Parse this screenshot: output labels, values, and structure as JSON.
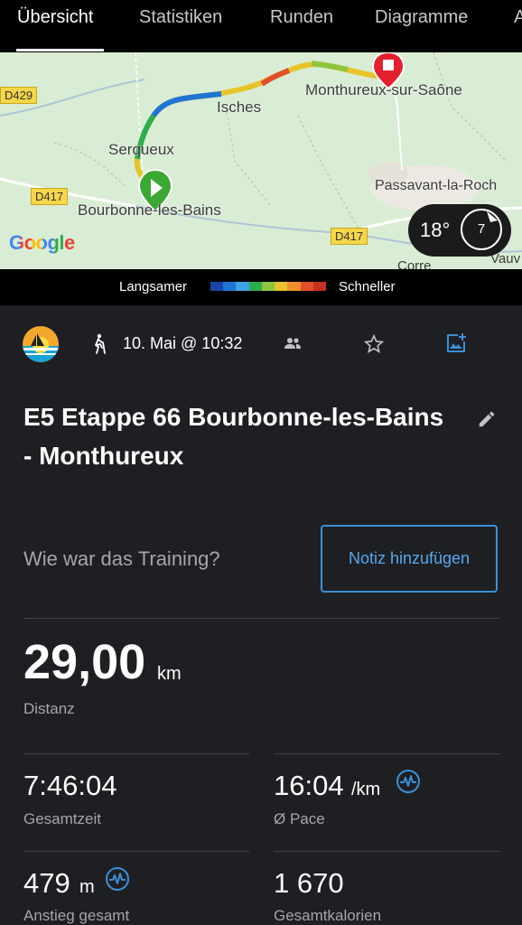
{
  "tabs": [
    {
      "label": "Übersicht"
    },
    {
      "label": "Statistiken"
    },
    {
      "label": "Runden"
    },
    {
      "label": "Diagramme"
    },
    {
      "label": "A"
    }
  ],
  "map": {
    "places": {
      "monthureux": "Monthureux-sur-Saône",
      "isches": "Isches",
      "serqueux": "Serqueux",
      "bourbonne": "Bourbonne-les-Bains",
      "passavant": "Passavant-la-Roch",
      "corre": "Corre",
      "vauv": "Vauv"
    },
    "roads": {
      "d429": "D429",
      "d417_a": "D417",
      "d417_b": "D417"
    },
    "logo": "Google",
    "weather": {
      "temperature": "18°",
      "wind": "7"
    }
  },
  "legend": {
    "slower": "Langsamer",
    "faster": "Schneller"
  },
  "activity": {
    "date": "10. Mai @ 10:32",
    "title": "E5 Etappe 66 Bourbonne-les-Bains - Monthureux"
  },
  "note": {
    "prompt": "Wie war das Training?",
    "button": "Notiz hinzufügen"
  },
  "stats": {
    "distance": {
      "value": "29,00",
      "unit": "km",
      "label": "Distanz"
    },
    "total_time": {
      "value": "7:46:04",
      "label": "Gesamtzeit"
    },
    "pace": {
      "value": "16:04",
      "unit": "/km",
      "label": "Ø Pace"
    },
    "ascent": {
      "value": "479",
      "unit": "m",
      "label": "Anstieg gesamt"
    },
    "calories": {
      "value": "1 670",
      "label": "Gesamtkalorien"
    }
  },
  "colors": {
    "accent": "#3b8fd9",
    "start_marker": "#3aa833",
    "end_marker": "#e4202e",
    "speed_scale": [
      "#1747a6",
      "#1f74d6",
      "#3fa4e6",
      "#2cae4a",
      "#8ec63f",
      "#e8c42a",
      "#f0902a",
      "#e2502a",
      "#c8301f"
    ]
  }
}
